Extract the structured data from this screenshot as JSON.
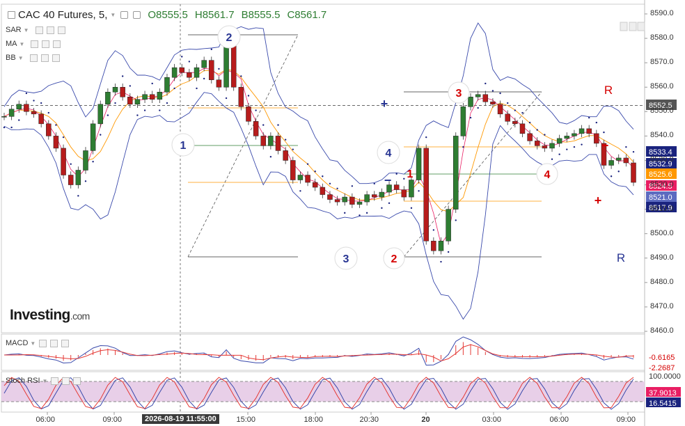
{
  "header": {
    "symbol": "CAC 40 Futures, 5,",
    "open": "O8555.5",
    "high": "H8561.7",
    "bid": "B8555.5",
    "close": "C8561.7"
  },
  "indicators": [
    "SAR",
    "MA",
    "BB"
  ],
  "logo": {
    "main": "Investing",
    "suffix": ".com"
  },
  "subpanels": {
    "macd_label": "MACD",
    "stoch_label": "Stoch RSI"
  },
  "crosshair_time": "2026-08-19 11:55:00",
  "chart_data": {
    "type": "candlestick",
    "y_axis": {
      "ylim": [
        8458,
        8593
      ],
      "ticks": [
        "8590.0",
        "8580.0",
        "8570.0",
        "8560.0",
        "8550.0",
        "8540.0",
        "8530.0",
        "8520.0",
        "8510.0",
        "8500.0",
        "8490.0",
        "8480.0",
        "8470.0",
        "8460.0"
      ]
    },
    "x_axis": {
      "ticks": [
        "06:00",
        "09:00",
        "15:00",
        "18:00",
        "20:30",
        "20",
        "03:00",
        "06:00",
        "09:00"
      ]
    },
    "price_labels": [
      {
        "value": "8552.5",
        "color": "#555555"
      },
      {
        "value": "8533.4",
        "color": "#1a237e"
      },
      {
        "value": "8532.9",
        "color": "#1a237e"
      },
      {
        "value": "8525.6",
        "color": "#ff9800"
      },
      {
        "value": "8524.5",
        "color": "#e91e63"
      },
      {
        "value": "8521.0",
        "color": "#5c6bc0"
      },
      {
        "value": "8517.9",
        "color": "#1a237e"
      }
    ],
    "series": [
      {
        "name": "Price",
        "values": [
          8548,
          8551,
          8553,
          8550,
          8549,
          8545,
          8540,
          8535,
          8524,
          8520,
          8526,
          8534,
          8545,
          8553,
          8558,
          8560,
          8556,
          8553,
          8555,
          8557,
          8555,
          8558,
          8564,
          8568,
          8566,
          8564,
          8568,
          8571,
          8563,
          8560,
          8578,
          8560,
          8552,
          8546,
          8540,
          8536,
          8540,
          8534,
          8530,
          8522,
          8524,
          8521,
          8519,
          8516,
          8514,
          8513,
          8515,
          8512,
          8513,
          8516,
          8515,
          8517,
          8520,
          8518,
          8515,
          8522,
          8535,
          8497,
          8493,
          8497,
          8510,
          8540,
          8552,
          8556,
          8557,
          8554,
          8553,
          8549,
          8546,
          8545,
          8541,
          8538,
          8536,
          8535,
          8537,
          8539,
          8540,
          8541,
          8543,
          8541,
          8537,
          8528,
          8530,
          8531,
          8529,
          8521
        ]
      }
    ],
    "annotations": {
      "horizontal_line": "8552.5",
      "wave_labels_blue": [
        "2",
        "1",
        "4",
        "3"
      ],
      "wave_labels_red": [
        "3",
        "1",
        "2",
        "4"
      ],
      "signs": [
        "+",
        "−",
        "+",
        "−"
      ],
      "letters": [
        "R",
        "R"
      ]
    },
    "macd": {
      "values": [
        "-0.6165",
        "-2.2687"
      ]
    },
    "stoch_rsi": {
      "levels": [
        "100.0000"
      ],
      "values": [
        "37.9013",
        "16.5415"
      ]
    }
  }
}
